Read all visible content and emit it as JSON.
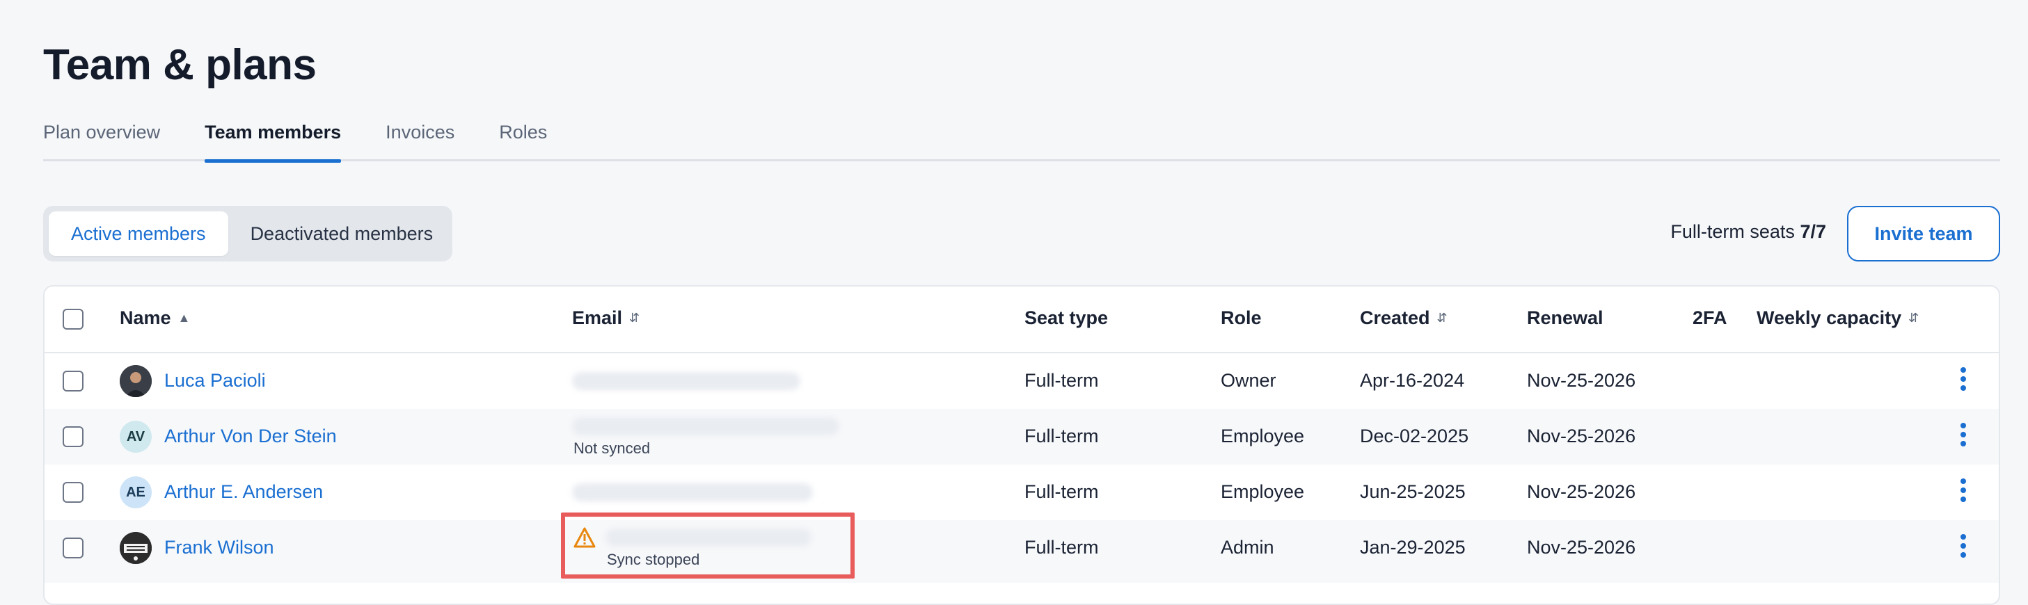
{
  "page": {
    "title": "Team & plans"
  },
  "tabs": [
    {
      "label": "Plan overview",
      "active": false
    },
    {
      "label": "Team members",
      "active": true
    },
    {
      "label": "Invoices",
      "active": false
    },
    {
      "label": "Roles",
      "active": false
    }
  ],
  "member_filter": {
    "options": [
      "Active members",
      "Deactivated members"
    ],
    "selected": "Active members"
  },
  "seats": {
    "label": "Full-term seats",
    "value": "7/7"
  },
  "invite_button": {
    "label": "Invite team"
  },
  "colors": {
    "accent": "#1a6fd1",
    "highlight": "#e85c5c",
    "warning": "#e8870e"
  },
  "table": {
    "columns": [
      {
        "label": "Name",
        "sort": "asc"
      },
      {
        "label": "Email",
        "sort": "both"
      },
      {
        "label": "Seat type",
        "sort": "none"
      },
      {
        "label": "Role",
        "sort": "none"
      },
      {
        "label": "Created",
        "sort": "both"
      },
      {
        "label": "Renewal",
        "sort": "none"
      },
      {
        "label": "2FA",
        "sort": "none"
      },
      {
        "label": "Weekly capacity",
        "sort": "both"
      }
    ],
    "rows": [
      {
        "name": "Luca Pacioli",
        "avatar": "photo",
        "email_status": "",
        "seat_type": "Full-term",
        "role": "Owner",
        "created": "Apr-16-2024",
        "renewal": "Nov-25-2026",
        "twofa": "",
        "capacity": ""
      },
      {
        "name": "Arthur Von Der Stein",
        "avatar": "AV",
        "email_status": "Not synced",
        "seat_type": "Full-term",
        "role": "Employee",
        "created": "Dec-02-2025",
        "renewal": "Nov-25-2026",
        "twofa": "",
        "capacity": ""
      },
      {
        "name": "Arthur E. Andersen",
        "avatar": "AE",
        "email_status": "",
        "seat_type": "Full-term",
        "role": "Employee",
        "created": "Jun-25-2025",
        "renewal": "Nov-25-2026",
        "twofa": "",
        "capacity": ""
      },
      {
        "name": "Frank Wilson",
        "avatar": "logo",
        "email_status": "Sync stopped",
        "seat_type": "Full-term",
        "role": "Admin",
        "created": "Jan-29-2025",
        "renewal": "Nov-25-2026",
        "twofa": "",
        "capacity": ""
      }
    ]
  },
  "icons": {
    "sort_asc": "⌃",
    "sort_both": "⇕",
    "warning": "warning-triangle-icon",
    "kebab": "more-vertical-icon"
  }
}
